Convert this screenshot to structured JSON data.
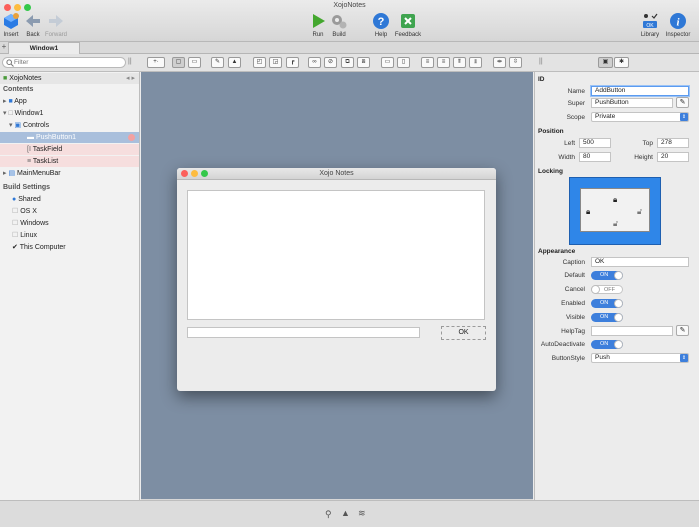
{
  "app": {
    "title": "XojoNotes"
  },
  "toolbar": {
    "insert": "Insert",
    "back": "Back",
    "forward": "Forward",
    "run": "Run",
    "build": "Build",
    "help": "Help",
    "feedback": "Feedback",
    "library": "Library",
    "inspector": "Inspector"
  },
  "tabs": {
    "add": "+",
    "window1": "Window1"
  },
  "navigator": {
    "search_placeholder": "Filter",
    "project": "XojoNotes",
    "contents_header": "Contents",
    "items": {
      "app": "App",
      "window1": "Window1",
      "controls": "Controls",
      "pushbutton1": "PushButton1",
      "taskfield": "TaskField",
      "tasklist": "TaskList",
      "mainmenubar": "MainMenuBar"
    },
    "build_header": "Build Settings",
    "build": {
      "shared": "Shared",
      "osx": "OS X",
      "windows": "Windows",
      "linux": "Linux",
      "this_computer": "This Computer"
    }
  },
  "design_window": {
    "title": "Xojo Notes",
    "button_caption": "OK"
  },
  "inspector": {
    "id_header": "ID",
    "name_label": "Name",
    "name_value": "AddButton",
    "super_label": "Super",
    "super_value": "PushButton",
    "scope_label": "Scope",
    "scope_value": "Private",
    "position_header": "Position",
    "left_label": "Left",
    "left_value": "500",
    "top_label": "Top",
    "top_value": "278",
    "width_label": "Width",
    "width_value": "80",
    "height_label": "Height",
    "height_value": "20",
    "locking_header": "Locking",
    "appearance_header": "Appearance",
    "caption_label": "Caption",
    "caption_value": "OK",
    "default_label": "Default",
    "default_state": "ON",
    "cancel_label": "Cancel",
    "cancel_state": "OFF",
    "enabled_label": "Enabled",
    "enabled_state": "ON",
    "visible_label": "Visible",
    "visible_state": "ON",
    "helptag_label": "HelpTag",
    "helptag_value": "",
    "autodeactivate_label": "AutoDeactivate",
    "autodeactivate_state": "ON",
    "buttonstyle_label": "ButtonStyle",
    "buttonstyle_value": "Push"
  },
  "colors": {
    "accent": "#3d7fdc",
    "canvas": "#7d8ea3",
    "selection": "#a9bfdc"
  }
}
